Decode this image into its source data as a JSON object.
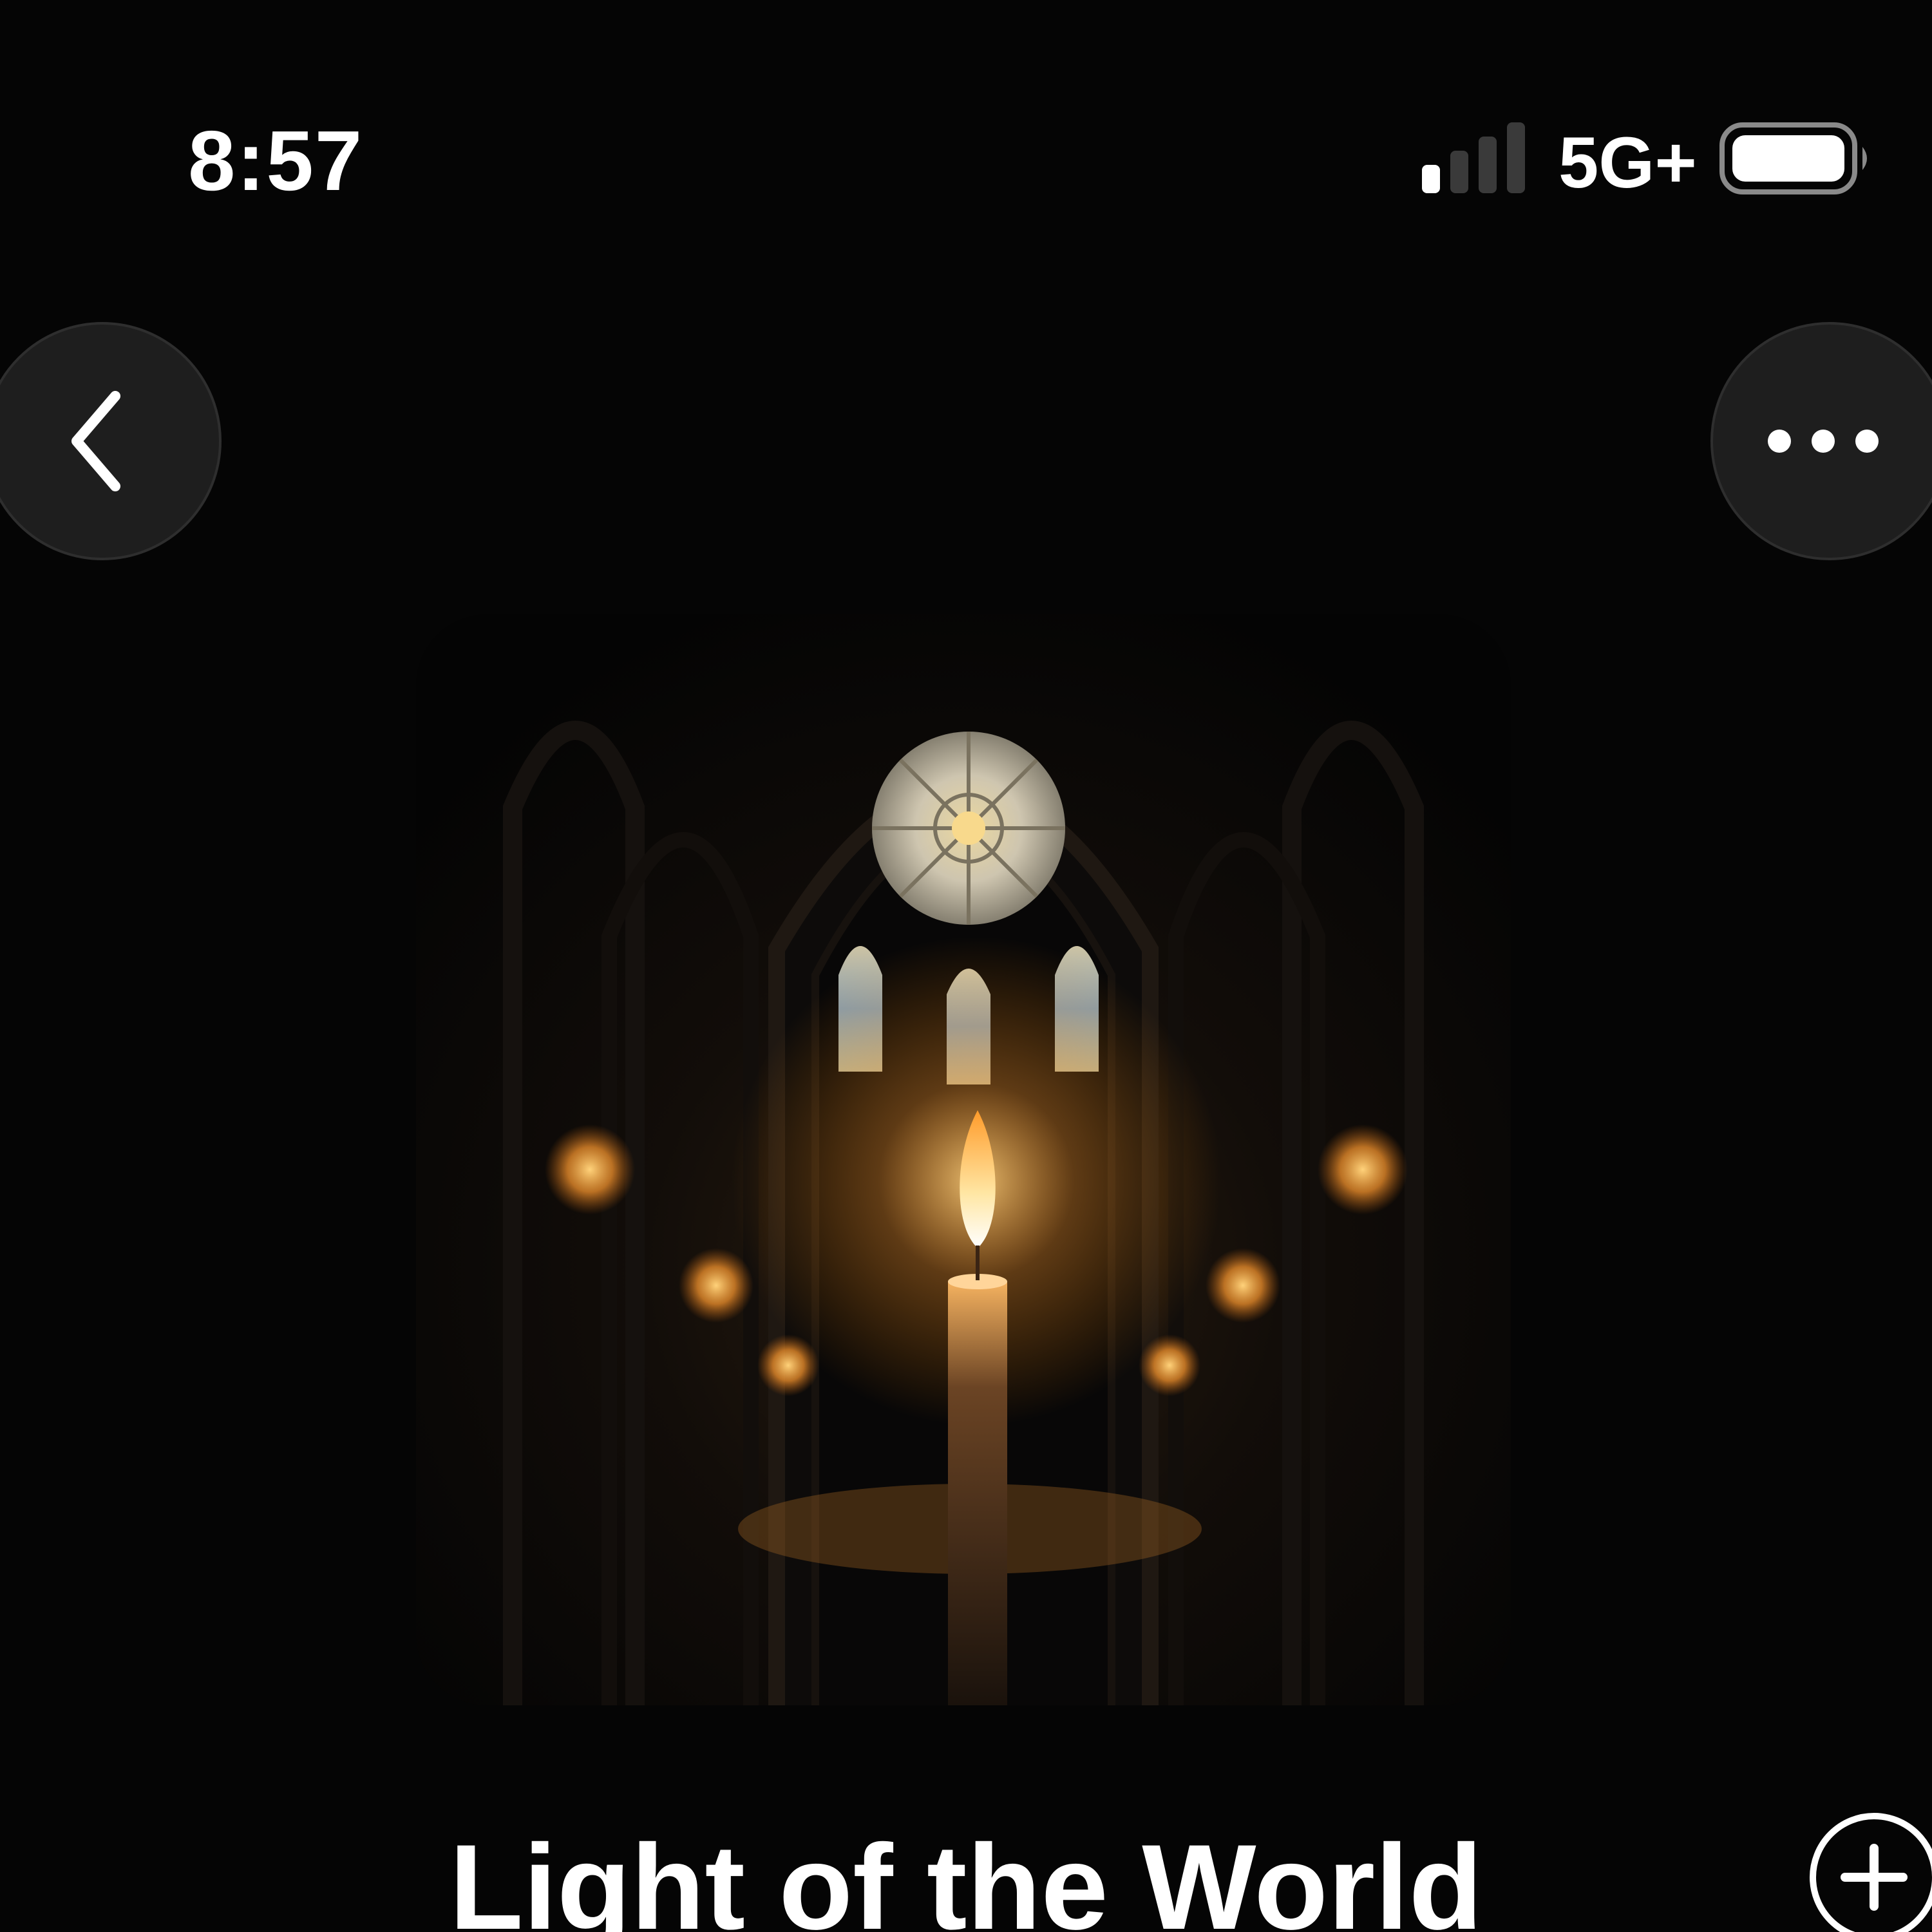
{
  "status_bar": {
    "time": "8:57",
    "network": "5G+",
    "icons": [
      "signal-bars-icon",
      "battery-icon"
    ]
  },
  "nav": {
    "back_icon": "chevron-left-icon",
    "more_icon": "ellipsis-icon"
  },
  "artwork": {
    "description_icon": "album-artwork-image"
  },
  "track": {
    "title": "Light of the World",
    "add_icon": "plus-circle-icon"
  },
  "colors": {
    "background": "#050505",
    "button_bg": "#1e1e1e",
    "text": "#ffffff",
    "candle_glow": "#ffb347"
  }
}
